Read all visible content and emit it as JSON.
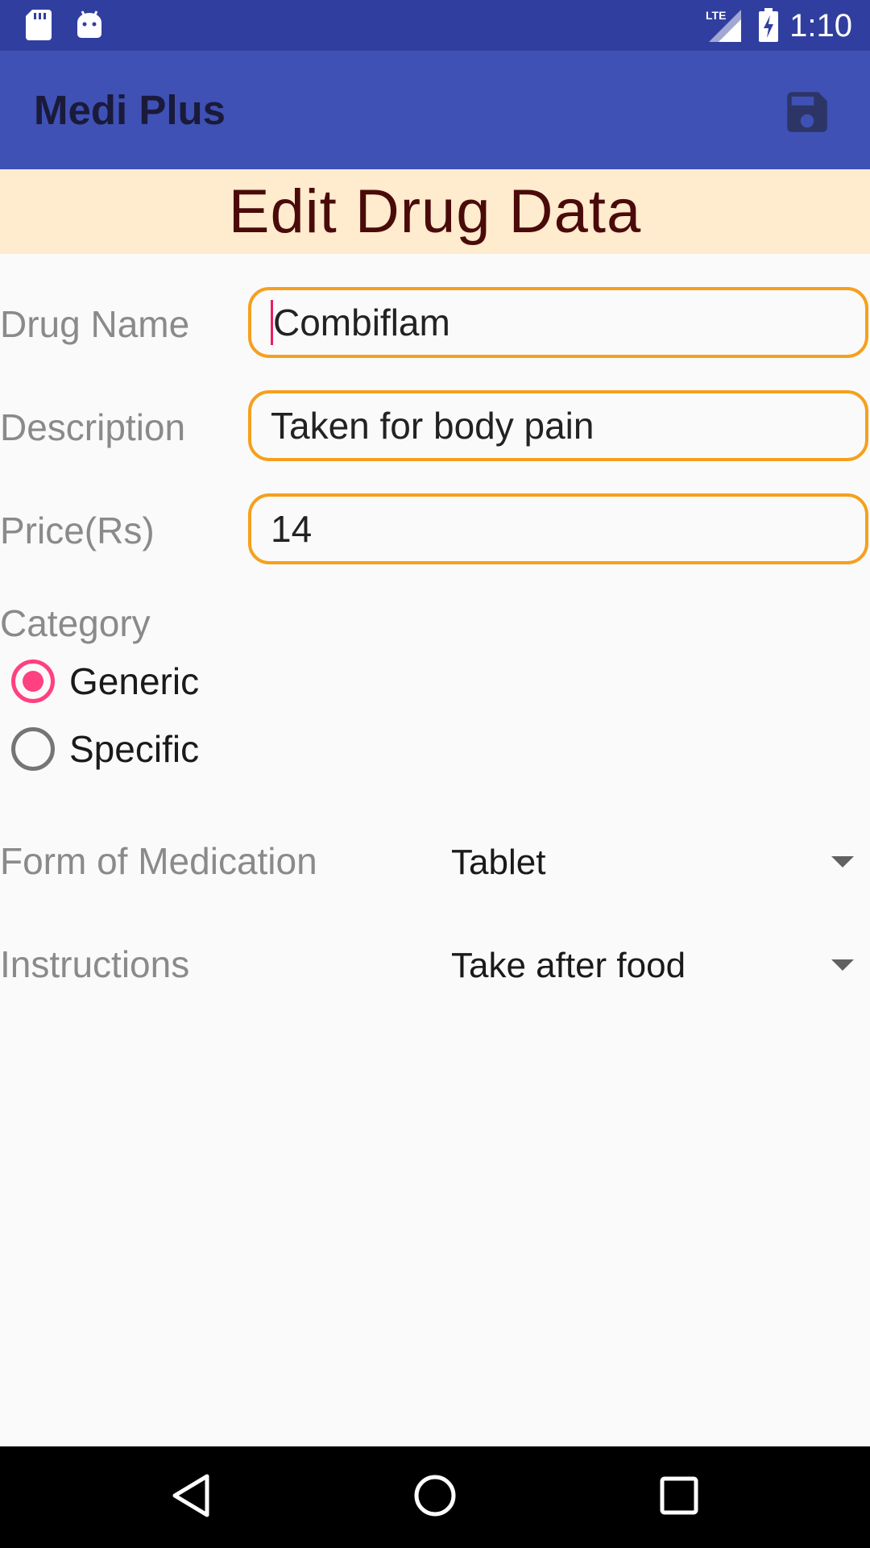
{
  "status_bar": {
    "time": "1:10",
    "network_label": "LTE",
    "icons": [
      "sd-card-icon",
      "android-icon",
      "lte-signal-icon",
      "battery-charging-icon"
    ]
  },
  "app_bar": {
    "title": "Medi Plus",
    "action_icon": "save-icon"
  },
  "page": {
    "heading": "Edit Drug Data"
  },
  "form": {
    "drug_name": {
      "label": "Drug Name",
      "value": "Combiflam"
    },
    "description": {
      "label": "Description",
      "value": "Taken for body pain"
    },
    "price": {
      "label": "Price(Rs)",
      "value": "14"
    },
    "category": {
      "label": "Category",
      "options": [
        {
          "label": "Generic",
          "checked": true
        },
        {
          "label": "Specific",
          "checked": false
        }
      ]
    },
    "form_of_medication": {
      "label": "Form of Medication",
      "selected": "Tablet"
    },
    "instructions": {
      "label": "Instructions",
      "selected": "Take after food"
    }
  },
  "nav_bar": {
    "icons": [
      "back-icon",
      "home-icon",
      "recents-icon"
    ]
  },
  "colors": {
    "status_bar": "#303f9f",
    "app_bar": "#3f51b5",
    "banner_bg": "#ffebcd",
    "banner_text": "#4a0a0a",
    "field_border": "#f5a01d",
    "radio_accent": "#ff4081"
  }
}
